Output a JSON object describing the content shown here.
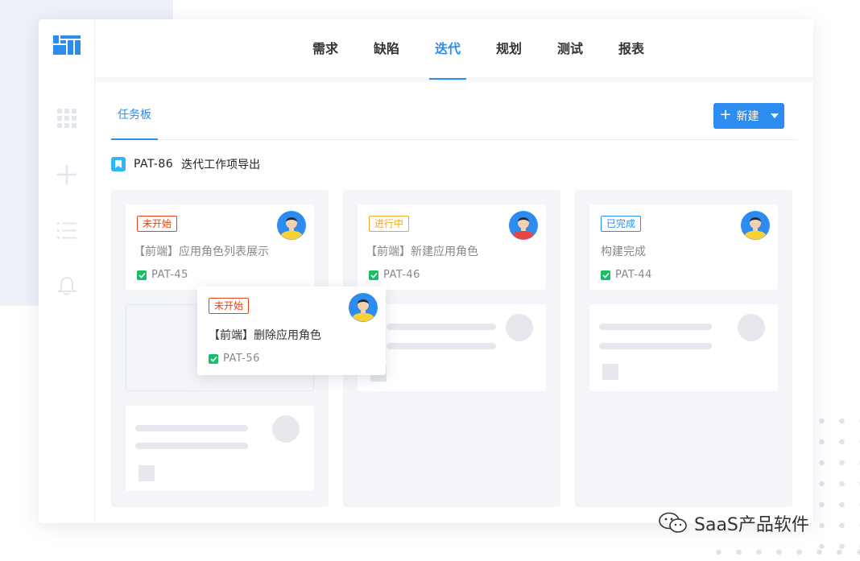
{
  "nav": {
    "items": [
      "需求",
      "缺陷",
      "迭代",
      "规划",
      "测试",
      "报表"
    ],
    "active": "迭代"
  },
  "subbar": {
    "tab_label": "任务板",
    "new_button_label": "新建"
  },
  "iteration": {
    "key": "PAT-86",
    "name": "迭代工作项导出"
  },
  "columns": [
    {
      "card": {
        "status": "未开始",
        "title": "【前端】应用角色列表展示",
        "key": "PAT-45",
        "avatar_shirt": "#f8d136"
      }
    },
    {
      "card": {
        "status": "进行中",
        "title": "【前端】新建应用角色",
        "key": "PAT-46",
        "avatar_shirt": "#e94545"
      }
    },
    {
      "card": {
        "status": "已完成",
        "title": "构建完成",
        "key": "PAT-44",
        "avatar_shirt": "#f8d136"
      }
    }
  ],
  "floating_card": {
    "status": "未开始",
    "title": "【前端】删除应用角色",
    "key": "PAT-56",
    "avatar_shirt": "#f8d136"
  },
  "watermark": {
    "text": "SaaS产品软件"
  },
  "colors": {
    "accent": "#2d8cf0",
    "status_not_started": "#ed4014",
    "status_in_progress": "#f5a623",
    "status_done": "#2d8cf0",
    "check": "#19be6b"
  }
}
